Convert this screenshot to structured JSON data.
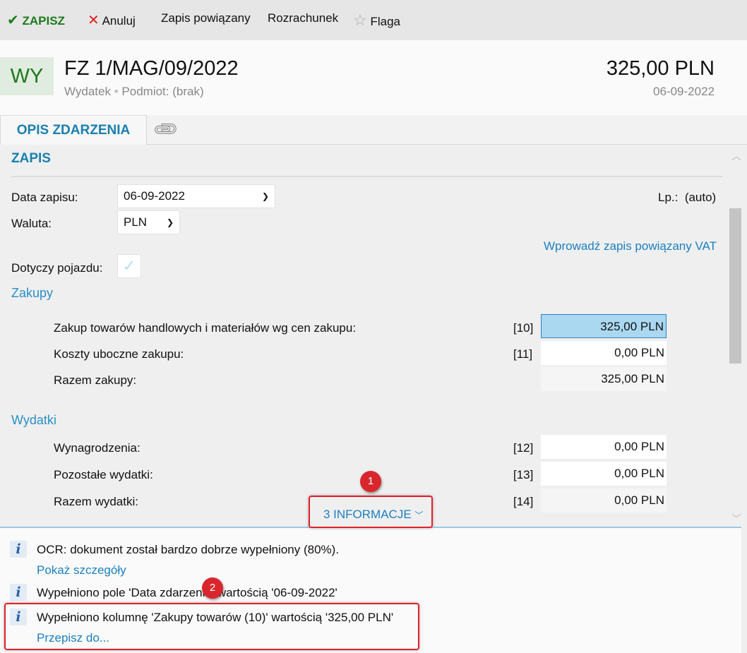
{
  "toolbar": {
    "save": "ZAPISZ",
    "cancel": "Anuluj",
    "linked_entry": "Zapis powiązany",
    "settlement": "Rozrachunek",
    "flag": "Flaga"
  },
  "header": {
    "badge": "WY",
    "title": "FZ 1/MAG/09/2022",
    "type": "Wydatek",
    "separator": "•",
    "subject": "Podmiot: (brak)",
    "amount": "325,00 PLN",
    "date": "06-09-2022"
  },
  "tabs": {
    "active": "OPIS ZDARZENIA"
  },
  "form": {
    "section_title": "ZAPIS",
    "date_label": "Data zapisu:",
    "date_value": "06-09-2022",
    "currency_label": "Waluta:",
    "currency_value": "PLN",
    "lp_label": "Lp.:",
    "lp_value": "(auto)",
    "vat_link": "Wprowadź zapis powiązany VAT",
    "vehicle_label": "Dotyczy pojazdu:",
    "purchases": {
      "title": "Zakupy",
      "rows": [
        {
          "label": "Zakup towarów handlowych i materiałów wg cen zakupu:",
          "code": "[10]",
          "value": "325,00 PLN"
        },
        {
          "label": "Koszty uboczne zakupu:",
          "code": "[11]",
          "value": "0,00 PLN"
        },
        {
          "label": "Razem zakupy:",
          "code": "",
          "value": "325,00 PLN"
        }
      ]
    },
    "expenses": {
      "title": "Wydatki",
      "rows": [
        {
          "label": "Wynagrodzenia:",
          "code": "[12]",
          "value": "0,00 PLN"
        },
        {
          "label": "Pozostałe wydatki:",
          "code": "[13]",
          "value": "0,00 PLN"
        },
        {
          "label": "Razem wydatki:",
          "code": "[14]",
          "value": "0,00 PLN"
        }
      ]
    }
  },
  "info_toggle": "3 INFORMACJE",
  "markers": [
    "1",
    "2"
  ],
  "info": [
    {
      "text": "OCR: dokument został bardzo dobrze wypełniony (80%).",
      "link": "Pokaż szczegóły"
    },
    {
      "text": "Wypełniono pole 'Data zdarzenia' wartością '06-09-2022'"
    },
    {
      "text": "Wypełniono kolumnę 'Zakupy towarów (10)' wartością '325,00 PLN'",
      "link": "Przepisz do..."
    }
  ],
  "colors": {
    "accent": "#1a7fae",
    "save_green": "#1d7a1d",
    "highlight": "#aad8f0",
    "annotation_red": "#e0202a"
  }
}
